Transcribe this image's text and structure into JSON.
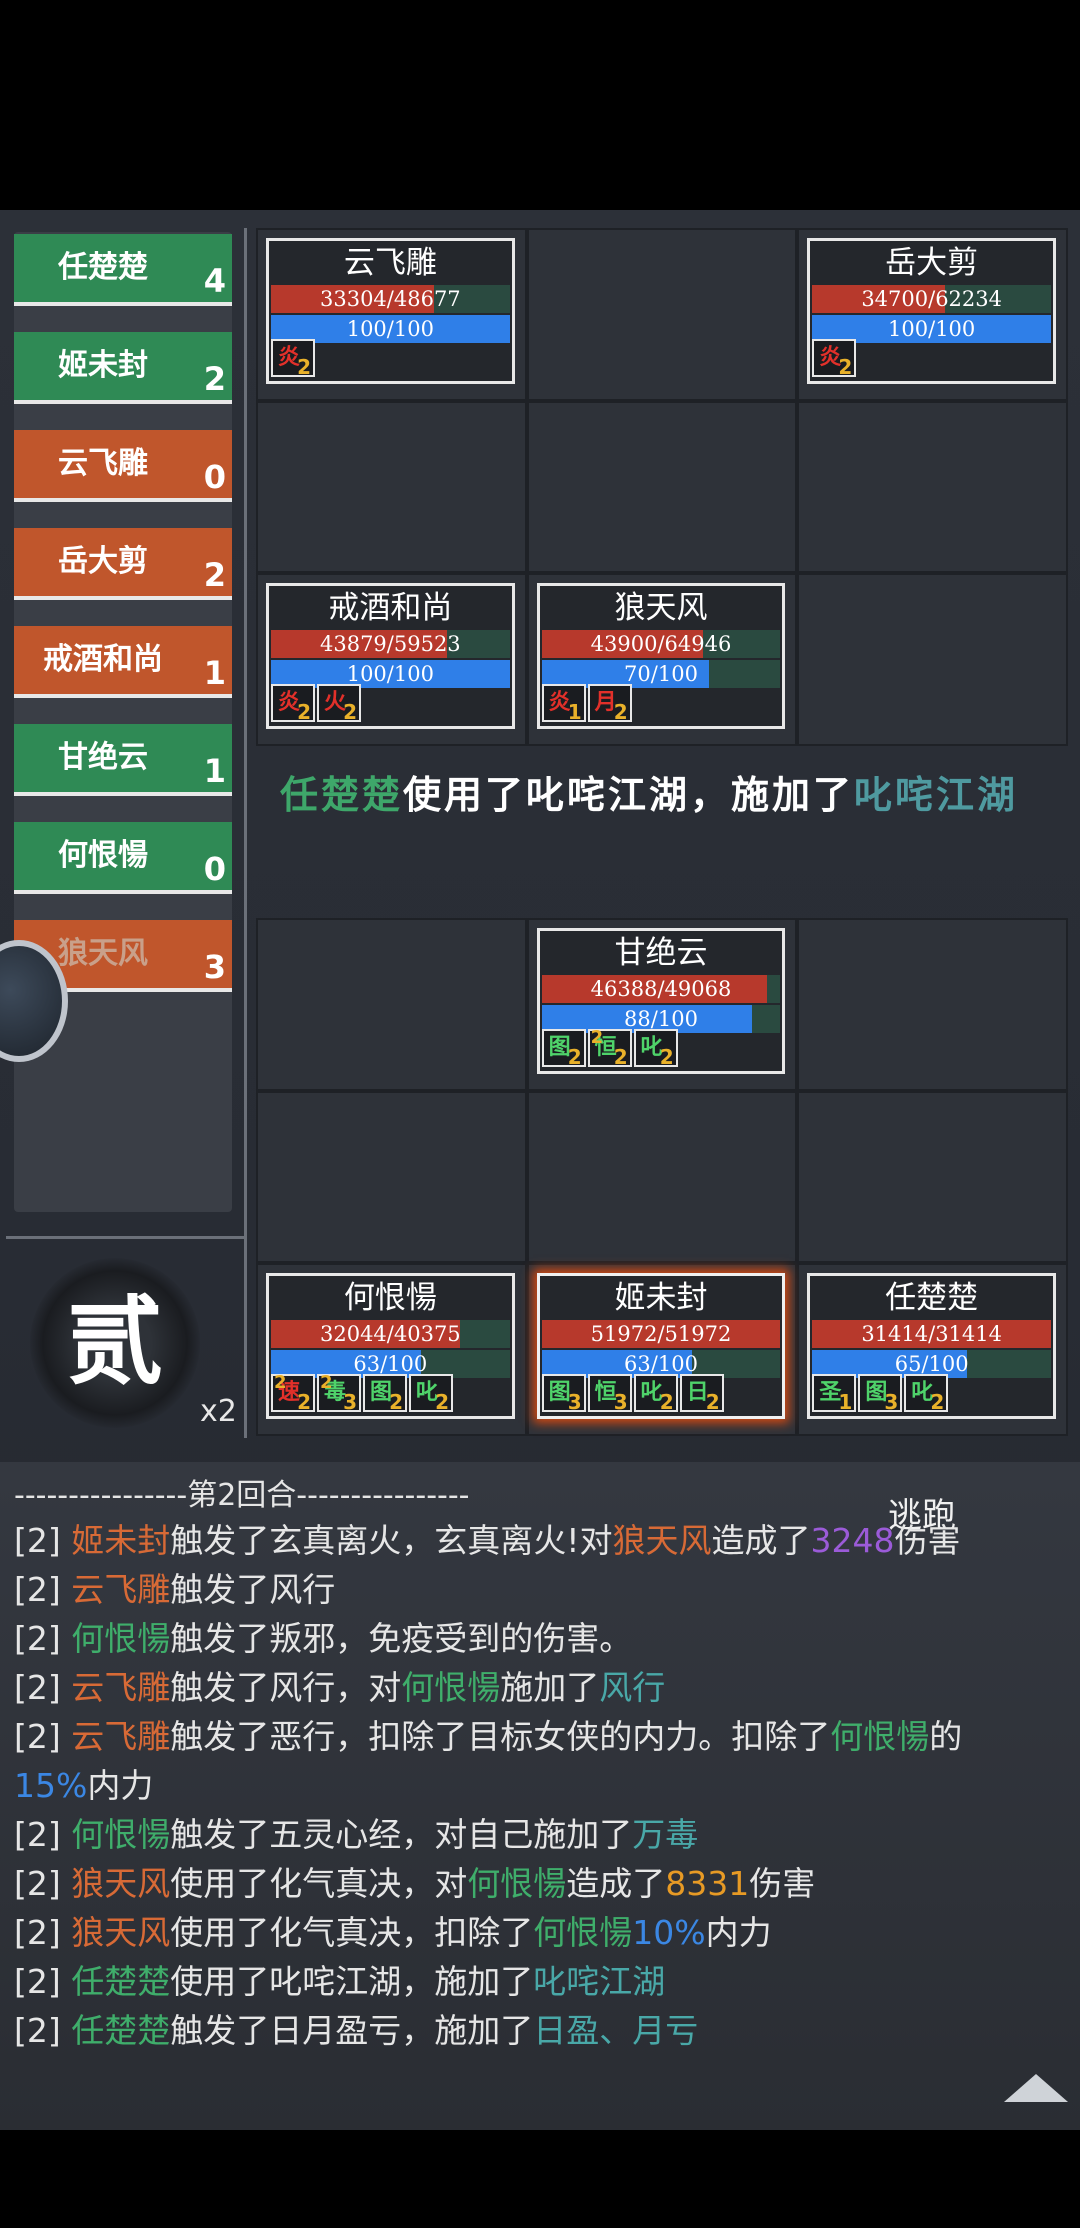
{
  "turn_order": [
    {
      "name": "任楚楚",
      "count": "4",
      "side": "ally"
    },
    {
      "name": "姬未封",
      "count": "2",
      "side": "ally"
    },
    {
      "name": "云飞雕",
      "count": "0",
      "side": "enemy"
    },
    {
      "name": "岳大剪",
      "count": "2",
      "side": "enemy"
    },
    {
      "name": "戒酒和尚",
      "count": "1",
      "side": "enemy"
    },
    {
      "name": "甘绝云",
      "count": "1",
      "side": "ally"
    },
    {
      "name": "何恨愓",
      "count": "0",
      "side": "ally"
    },
    {
      "name": "狼天风",
      "count": "3",
      "side": "enemy"
    }
  ],
  "round": {
    "char": "贰",
    "speed": "x2"
  },
  "enemy_units": [
    {
      "name": "云飞雕",
      "hp": "33304/48677",
      "hp_frac": 0.684,
      "mp": "100/100",
      "mp_frac": 1.0,
      "buffs": [
        {
          "t": "炎",
          "n": "2",
          "c": "red"
        }
      ]
    },
    {
      "name": "岳大剪",
      "hp": "34700/62234",
      "hp_frac": 0.558,
      "mp": "100/100",
      "mp_frac": 1.0,
      "buffs": [
        {
          "t": "炎",
          "n": "2",
          "c": "red"
        }
      ]
    },
    {
      "name": "戒酒和尚",
      "hp": "43879/59523",
      "hp_frac": 0.737,
      "mp": "100/100",
      "mp_frac": 1.0,
      "buffs": [
        {
          "t": "炎",
          "n": "2",
          "c": "red"
        },
        {
          "t": "火",
          "n": "2",
          "c": "red"
        }
      ]
    },
    {
      "name": "狼天风",
      "hp": "43900/64946",
      "hp_frac": 0.676,
      "mp": "70/100",
      "mp_frac": 0.7,
      "buffs": [
        {
          "t": "炎",
          "n": "1",
          "c": "red"
        },
        {
          "t": "月",
          "n": "2",
          "c": "red"
        }
      ]
    }
  ],
  "ally_units": [
    {
      "name": "甘绝云",
      "hp": "46388/49068",
      "hp_frac": 0.945,
      "mp": "88/100",
      "mp_frac": 0.88,
      "buffs": [
        {
          "t": "图",
          "n": "2",
          "c": "green"
        },
        {
          "t": "恒",
          "n": "2",
          "s": "2",
          "c": "green"
        },
        {
          "t": "叱",
          "n": "2",
          "c": "green"
        }
      ]
    },
    {
      "name": "何恨愓",
      "hp": "32044/40375",
      "hp_frac": 0.794,
      "mp": "63/100",
      "mp_frac": 0.63,
      "buffs": [
        {
          "t": "速",
          "n": "2",
          "s": "2",
          "c": "red"
        },
        {
          "t": "毒",
          "n": "3",
          "s": "2",
          "c": "green"
        },
        {
          "t": "图",
          "n": "2",
          "c": "green"
        },
        {
          "t": "叱",
          "n": "2",
          "c": "green"
        }
      ]
    },
    {
      "name": "姬未封",
      "hp": "51972/51972",
      "hp_frac": 1.0,
      "mp": "63/100",
      "mp_frac": 0.63,
      "active": true,
      "buffs": [
        {
          "t": "图",
          "n": "3",
          "c": "green"
        },
        {
          "t": "恒",
          "n": "3",
          "c": "green"
        },
        {
          "t": "叱",
          "n": "2",
          "c": "green"
        },
        {
          "t": "日",
          "n": "2",
          "c": "green"
        }
      ]
    },
    {
      "name": "任楚楚",
      "hp": "31414/31414",
      "hp_frac": 1.0,
      "mp": "65/100",
      "mp_frac": 0.65,
      "buffs": [
        {
          "t": "圣",
          "n": "1",
          "c": "green"
        },
        {
          "t": "图",
          "n": "3",
          "c": "green"
        },
        {
          "t": "叱",
          "n": "2",
          "c": "green"
        }
      ]
    }
  ],
  "action_message": {
    "actor": "任楚楚",
    "mid": "使用了叱咤江湖，施加了",
    "skill": "叱咤江湖"
  },
  "log_title": "----------------第2回合----------------",
  "escape_label": "逃跑",
  "log": [
    [
      [
        "[2] ",
        ""
      ],
      [
        "姬未封",
        "o"
      ],
      [
        "触发了玄真离火，玄真离火!对",
        ""
      ],
      [
        "狼天风",
        "o"
      ],
      [
        "造成了",
        ""
      ],
      [
        "3248",
        "p"
      ],
      [
        "伤害",
        ""
      ]
    ],
    [
      [
        "[2] ",
        ""
      ],
      [
        "云飞雕",
        "o"
      ],
      [
        "触发了风行",
        ""
      ]
    ],
    [
      [
        "[2] ",
        ""
      ],
      [
        "何恨愓",
        "g"
      ],
      [
        "触发了叛邪，免疫受到的伤害。",
        ""
      ]
    ],
    [
      [
        "[2] ",
        ""
      ],
      [
        "云飞雕",
        "o"
      ],
      [
        "触发了风行，对",
        ""
      ],
      [
        "何恨愓",
        "g"
      ],
      [
        "施加了",
        ""
      ],
      [
        "风行",
        "t"
      ]
    ],
    [
      [
        "[2] ",
        ""
      ],
      [
        "云飞雕",
        "o"
      ],
      [
        "触发了恶行，扣除了目标女侠的内力。扣除了",
        ""
      ],
      [
        "何恨愓",
        "g"
      ],
      [
        "的",
        ""
      ]
    ],
    [
      [
        "15%",
        "b"
      ],
      [
        "内力",
        ""
      ]
    ],
    [
      [
        "[2] ",
        ""
      ],
      [
        "何恨愓",
        "g"
      ],
      [
        "触发了五灵心经，对自己施加了",
        ""
      ],
      [
        "万毒",
        "t"
      ]
    ],
    [
      [
        "[2] ",
        ""
      ],
      [
        "狼天风",
        "o"
      ],
      [
        "使用了化气真决，对",
        ""
      ],
      [
        "何恨愓",
        "g"
      ],
      [
        "造成了",
        ""
      ],
      [
        "8331",
        "y"
      ],
      [
        "伤害",
        ""
      ]
    ],
    [
      [
        "[2] ",
        ""
      ],
      [
        "狼天风",
        "o"
      ],
      [
        "使用了化气真决，扣除了",
        ""
      ],
      [
        "何恨愓",
        "g"
      ],
      [
        "10%",
        "b"
      ],
      [
        "内力",
        ""
      ]
    ],
    [
      [
        "[2] ",
        ""
      ],
      [
        "任楚楚",
        "g"
      ],
      [
        "使用了叱咤江湖，施加了",
        ""
      ],
      [
        "叱咤江湖",
        "t"
      ]
    ],
    [
      [
        "[2] ",
        ""
      ],
      [
        "任楚楚",
        "g"
      ],
      [
        "触发了日月盈亏，施加了",
        ""
      ],
      [
        "日盈、月亏",
        "t"
      ]
    ]
  ]
}
